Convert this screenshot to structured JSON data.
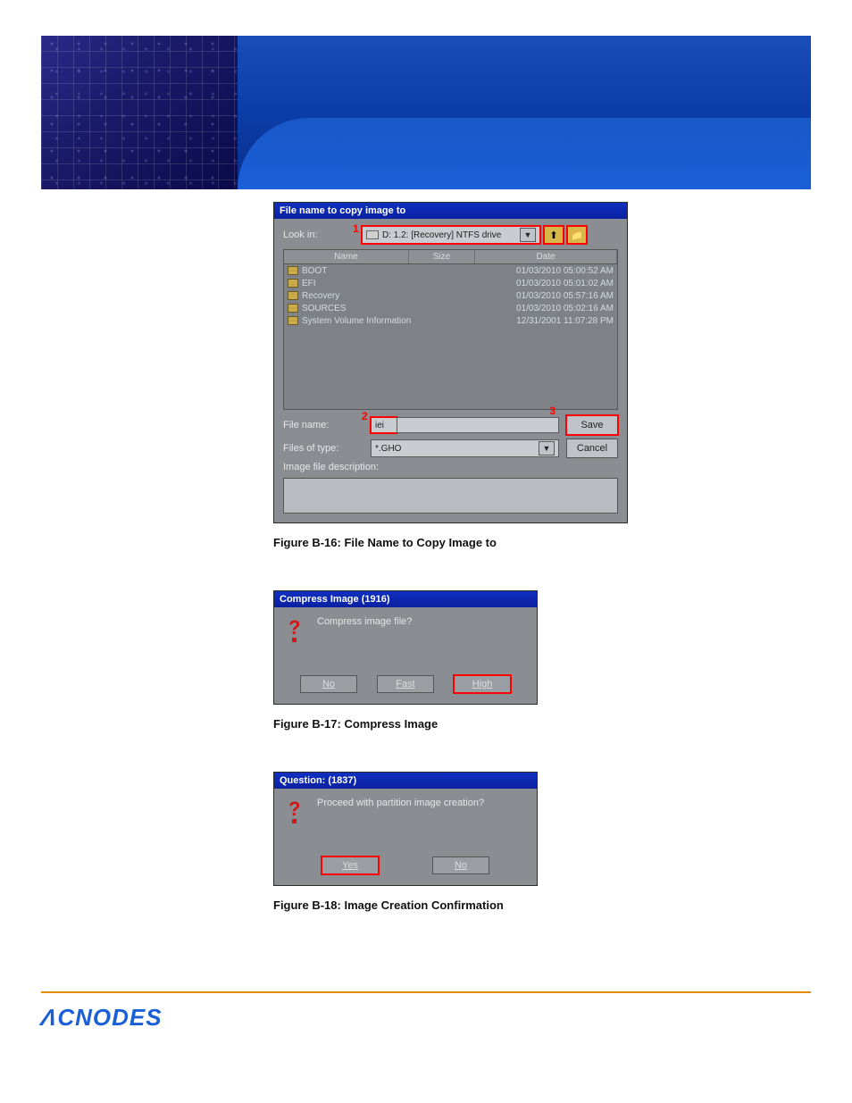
{
  "dialog1": {
    "title": "File name to copy image to",
    "look_in_label": "Look in:",
    "look_in_value": "D: 1.2: [Recovery] NTFS drive",
    "callouts": {
      "c1": "1",
      "c2": "2",
      "c3": "3"
    },
    "columns": {
      "name": "Name",
      "size": "Size",
      "date": "Date"
    },
    "rows": [
      {
        "name": "BOOT",
        "date": "01/03/2010 05:00:52 AM"
      },
      {
        "name": "EFI",
        "date": "01/03/2010 05:01:02 AM"
      },
      {
        "name": "Recovery",
        "date": "01/03/2010 05:57:16 AM"
      },
      {
        "name": "SOURCES",
        "date": "01/03/2010 05:02:16 AM"
      },
      {
        "name": "System Volume Information",
        "date": "12/31/2001 11:07:28 PM"
      }
    ],
    "file_name_label": "File name:",
    "file_name_value": "iei",
    "files_type_label": "Files of type:",
    "files_type_value": "*.GHO",
    "desc_label": "Image file description:",
    "save": "Save",
    "cancel": "Cancel"
  },
  "caption1": "Figure B-16: File Name to Copy Image to",
  "dialog2": {
    "title": "Compress Image (1916)",
    "message": "Compress image file?",
    "no": "No",
    "fast": "Fast",
    "high": "High"
  },
  "caption2": "Figure B-17: Compress Image",
  "dialog3": {
    "title": "Question: (1837)",
    "message": "Proceed with partition image creation?",
    "yes": "Yes",
    "no": "No"
  },
  "caption3": "Figure B-18: Image Creation Confirmation",
  "brand": "CNODES"
}
